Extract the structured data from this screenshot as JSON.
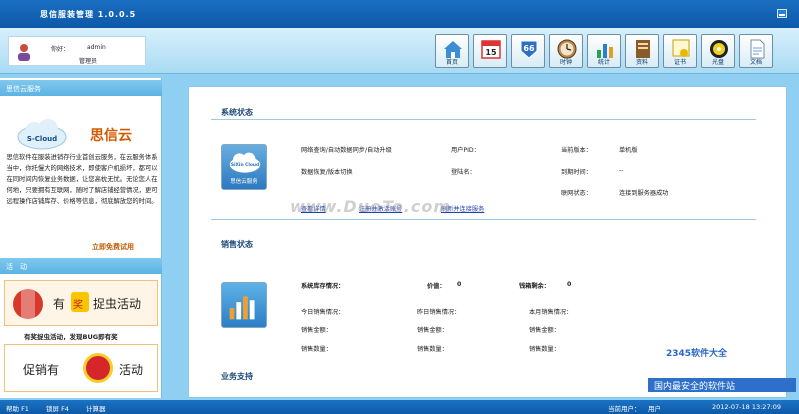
{
  "window": {
    "title": "思信服装管理 1.0.0.5"
  },
  "header": {
    "greeting": "你好：",
    "username": "admin",
    "role": "管理员",
    "toolbar": [
      {
        "icon": "home-icon",
        "label": "首页"
      },
      {
        "icon": "calendar-icon",
        "label": "15"
      },
      {
        "icon": "route66-icon",
        "label": "66"
      },
      {
        "icon": "clock-icon",
        "label": "时钟"
      },
      {
        "icon": "chart-icon",
        "label": "统计"
      },
      {
        "icon": "book-icon",
        "label": "资料"
      },
      {
        "icon": "certificate-icon",
        "label": "证书"
      },
      {
        "icon": "cd-icon",
        "label": "光盘"
      },
      {
        "icon": "document-icon",
        "label": "文档"
      }
    ]
  },
  "left": {
    "cloud_section": "思信云服务",
    "cloud_logo_text": "S-Cloud",
    "brand": "思信云",
    "intro": "思信软件在服装进销存行业首创云服务，在云服务体系当中，你托慢大的网络技术，即使客户机损坏，都可以在同时间内恢复业务数据，让您高枕无忧。无论您人在何地，只要拥有互联网，随时了解店铺经营情况，更可远程操作店铺库存、价格等信息，彻底解放您的时间。",
    "trial_link": "立即免费试用",
    "activity_section": "活　动",
    "promo1_prefix": "有",
    "promo1_badge": "奖",
    "promo1_suffix": "捉虫活动",
    "promo1_caption": "有奖捉虫活动，发现BUG即有奖",
    "promo2_prefix": "促销有",
    "promo2_suffix": "活动"
  },
  "system": {
    "title": "系统状态",
    "features_line1": "网络查询/自动数据同步/自动升级",
    "features_line2": "数据恢复/版本切换",
    "user_pid_label": "用户PID：",
    "user_pid_value": "",
    "reg_name_label": "登陆名：",
    "reg_name_value": "",
    "version_label": "当前版本：",
    "version_value": "单机版",
    "expire_label": "到期时间：",
    "expire_value": "--",
    "net_label": "联网状态：",
    "net_value": "连接到服务器成功",
    "link1": "查看详情",
    "link2": "注册并激活账号",
    "link3": "刷新并连接服务",
    "card_logo": "SiXin Cloud",
    "card_label": "思信云服务"
  },
  "sales": {
    "title": "销售状态",
    "stock_label": "系统库存情况：",
    "price_label": "价值：",
    "price_value": "0",
    "remaining_label": "钱箱剩余：",
    "remaining_value": "0",
    "today_label": "今日销售情况：",
    "yesterday_label": "昨日销售情况：",
    "month_label": "本月销售情况：",
    "amount_label": "销售金额：",
    "qty_label": "销售数量："
  },
  "support": {
    "title": "业务支持"
  },
  "statusbar": {
    "help": "帮助 F1",
    "lock": "锁屏 F4",
    "calc": "计算器",
    "current_user_label": "当前用户：",
    "current_user": "用户",
    "datetime": "2012-07-18 13:27:09"
  },
  "watermark": {
    "center": "www.DuoTe.com",
    "brand": "2345软件大全",
    "slogan": "国内最安全的软件站"
  },
  "colors": {
    "titlebar": "#1a6fc2",
    "accent_orange": "#d45a00",
    "link": "#1f3fb0"
  }
}
